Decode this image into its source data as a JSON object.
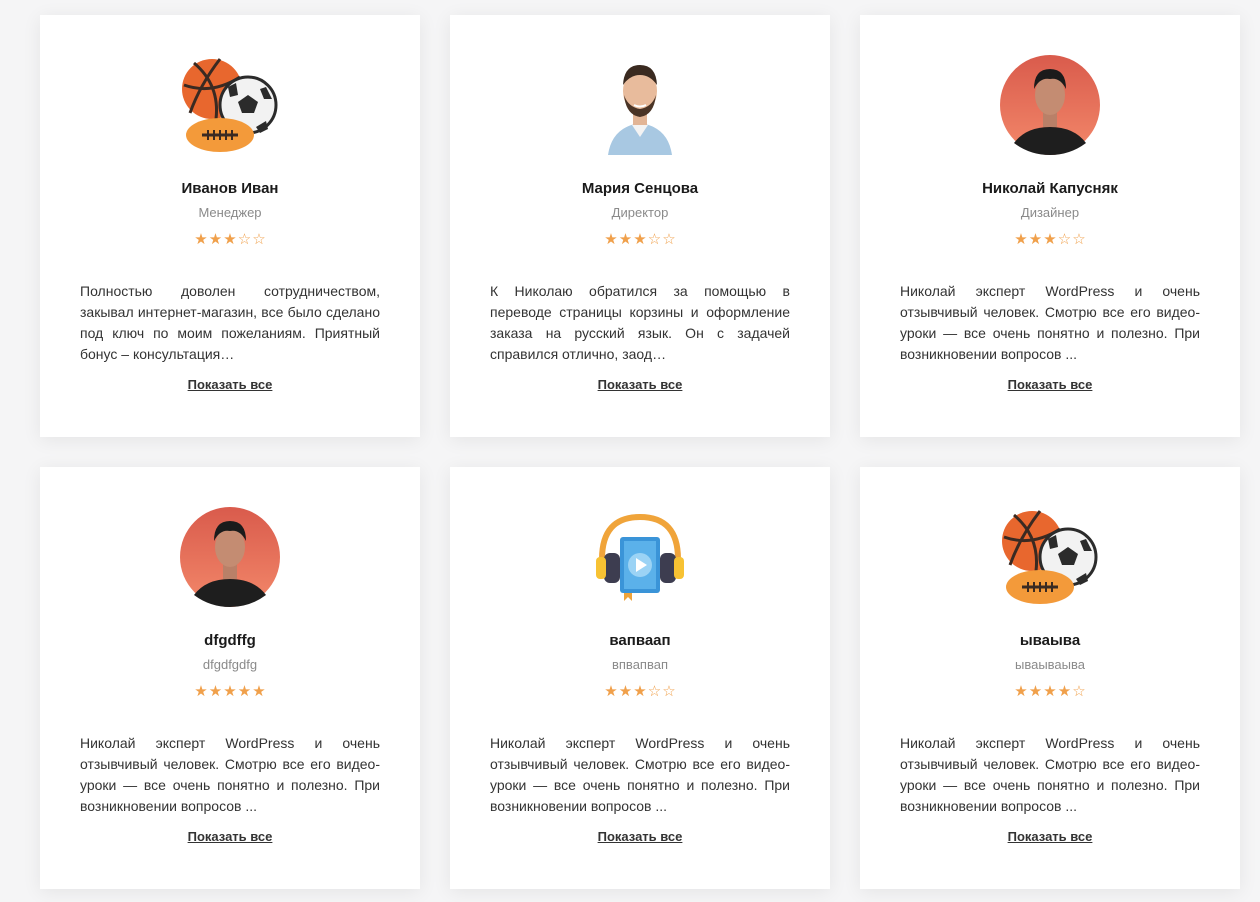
{
  "colors": {
    "star": "#f0a04b",
    "background": "#f5f5f6",
    "card": "#ffffff"
  },
  "reviews": [
    {
      "name": "Иванов Иван",
      "role": "Менеджер",
      "rating": 3,
      "avatar_icon": "sports-balls-icon",
      "text": "Полностью доволен сотрудничеством, закывал интернет-магазин, все было сделано под ключ по моим пожеланиям. Приятный бонус – консультация…",
      "more_label": "Показать все"
    },
    {
      "name": "Мария Сенцова",
      "role": "Директор",
      "rating": 3,
      "avatar_icon": "bearded-man-photo",
      "text": "К Николаю обратился за помощью в переводе страницы корзины и оформление заказа на русский язык. Он с задачей справился отлично, заод…",
      "more_label": "Показать все"
    },
    {
      "name": "Николай Капусняк",
      "role": "Дизайнер",
      "rating": 3,
      "avatar_icon": "man-portrait-photo",
      "text": "Николай эксперт WordPress и очень отзывчивый человек. Смотрю все его видео-уроки — все очень понятно и полезно. При возникновении вопросов ...",
      "more_label": "Показать все"
    },
    {
      "name": "dfgdffg",
      "role": "dfgdfgdfg",
      "rating": 5,
      "avatar_icon": "man-portrait-photo",
      "text": "Николай эксперт WordPress и очень отзывчивый человек. Смотрю все его видео-уроки — все очень понятно и полезно. При возникновении вопросов ...",
      "more_label": "Показать все"
    },
    {
      "name": "вапваап",
      "role": "впвапвап",
      "rating": 3,
      "avatar_icon": "headphones-video-icon",
      "text": "Николай эксперт WordPress и очень отзывчивый человек. Смотрю все его видео-уроки — все очень понятно и полезно. При возникновении вопросов ...",
      "more_label": "Показать все"
    },
    {
      "name": "ываыва",
      "role": "ываываыва",
      "rating": 4,
      "avatar_icon": "sports-balls-icon",
      "text": "Николай эксперт WordPress и очень отзывчивый человек. Смотрю все его видео-уроки — все очень понятно и полезно. При возникновении вопросов ...",
      "more_label": "Показать все"
    }
  ]
}
